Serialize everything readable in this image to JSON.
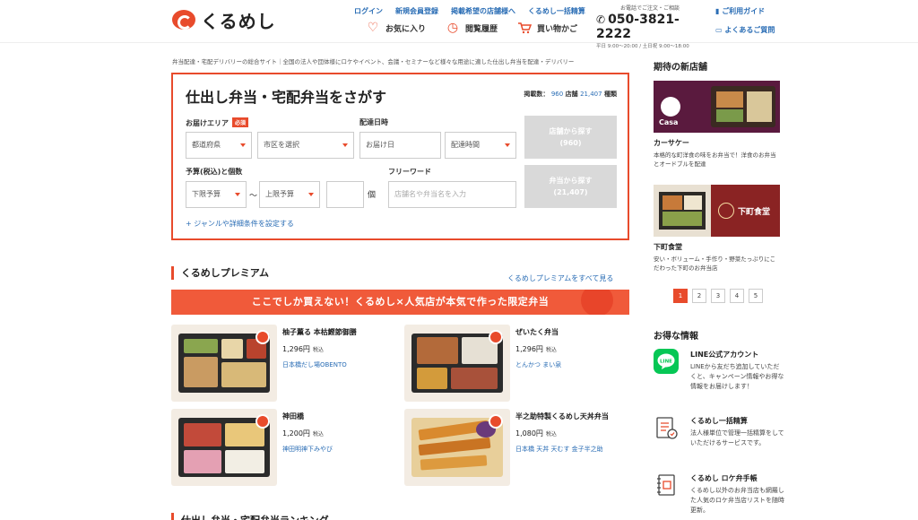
{
  "brand": {
    "name": "くるめし"
  },
  "header": {
    "links": [
      "ログイン",
      "新規会員登録",
      "掲載希望の店舗様へ",
      "くるめし一括精算"
    ],
    "icon_links": [
      {
        "label": "お気に入り",
        "icon": "heart-icon"
      },
      {
        "label": "閲覧履歴",
        "icon": "clock-icon"
      },
      {
        "label": "買い物かご",
        "icon": "cart-icon"
      }
    ],
    "phone_caption": "お電話でご注文・ご相談",
    "phone_number": "050-3821-2222",
    "phone_hours": "平日 9:00〜20:00 / 土日祝 9:00〜18:00",
    "guide_label": "ご利用ガイド",
    "faq_label": "よくあるご質問"
  },
  "intro": "弁当配達・宅配デリバリーの総合サイト｜全国の法人や団体様にロケやイベント、会議・セミナーなど様々な用途に適した仕出し弁当を配達・デリバリー",
  "search": {
    "title": "仕出し弁当・宅配弁当をさがす",
    "count_prefix": "掲載数：",
    "shops": "960",
    "shops_unit": "店舗",
    "items": "21,407",
    "items_unit": "種類",
    "area_label": "お届けエリア",
    "required": "必須",
    "pref": "都道府県",
    "city": "市区を選択",
    "date_label": "配達日時",
    "date_ph": "お届け日",
    "time": "配達時間",
    "budget_label": "予算(税込)と個数",
    "min": "下限予算",
    "max": "上限予算",
    "tilde": "〜",
    "unit": "個",
    "free_label": "フリーワード",
    "free_ph": "店舗名や弁当名を入力",
    "btn_shop": "店舗から探す",
    "btn_shop_n": "(960)",
    "btn_bento": "弁当から探す",
    "btn_bento_n": "(21,407)",
    "more": "+ ジャンルや詳細条件を設定する"
  },
  "premium": {
    "title": "くるめしプレミアム",
    "see_all": "くるめしプレミアムをすべて見る",
    "banner": "ここでしか買えない！くるめし×人気店が本気で作った限定弁当",
    "tax": "税込",
    "items": [
      {
        "name": "柚子薫る 本枯鰹節御膳",
        "price": "1,296円",
        "shop": "日本橋だし場OBENTO"
      },
      {
        "name": "ぜいたく弁当",
        "price": "1,296円",
        "shop": "とんかつ まい泉"
      },
      {
        "name": "神田橋",
        "price": "1,200円",
        "shop": "神田明神下みやび"
      },
      {
        "name": "半之助特製くるめし天丼弁当",
        "price": "1,080円",
        "shop": "日本橋 天丼 天むす 金子半之助"
      }
    ]
  },
  "ranking_title": "仕出し弁当・宅配弁当ランキング",
  "sidebar": {
    "new_title": "期待の新店舗",
    "shops": [
      {
        "name": "カーサケー",
        "desc": "本格的な町洋食の味をお弁当で！洋食のお弁当とオードブルを配達",
        "img_text": "Casa"
      },
      {
        "name": "下町食堂",
        "desc": "安い・ボリューム・手作り・野菜たっぷりにこだわった下町のお弁当店",
        "img_text": "下町食堂"
      }
    ],
    "pages": [
      "1",
      "2",
      "3",
      "4",
      "5"
    ],
    "deals_title": "お得な情報",
    "deals": [
      {
        "title": "LINE公式アカウント",
        "desc": "LINEから友だち追加していただくと、キャンペーン情報やお得な情報をお届けします！",
        "icon": "line-icon"
      },
      {
        "title": "くるめし一括精算",
        "desc": "法人様単位で管理一括精算をしていただけるサービスです。",
        "icon": "invoice-icon"
      },
      {
        "title": "くるめし ロケ弁手帳",
        "desc": "くるめし以外のお弁当店も網羅した人気のロケ弁当店リストを随時更新。",
        "icon": "notebook-icon"
      }
    ]
  }
}
